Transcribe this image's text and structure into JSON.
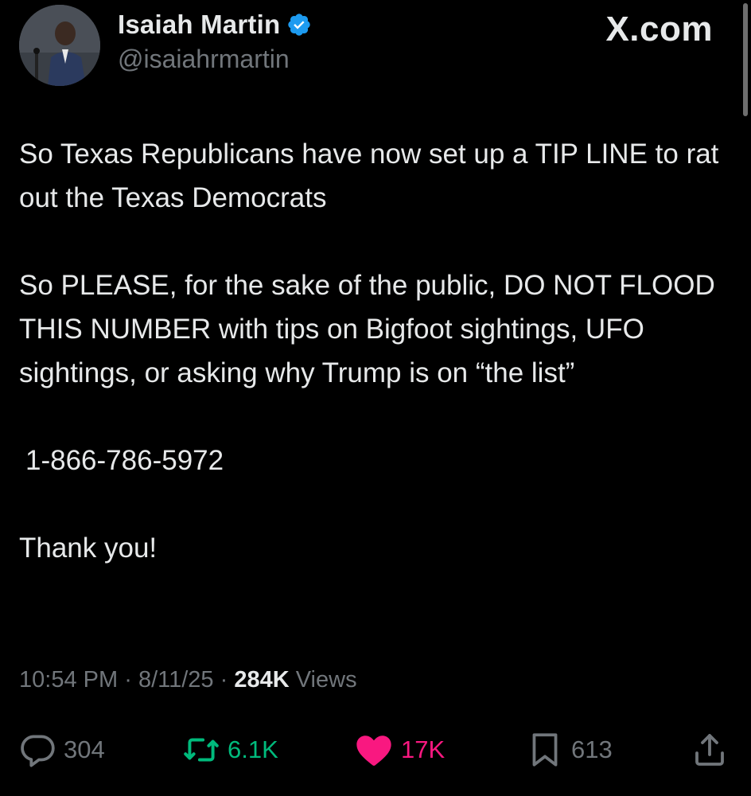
{
  "author": {
    "display_name": "Isaiah Martin",
    "handle": "@isaiahrmartin",
    "verified": true,
    "verified_color": "#1d9bf0"
  },
  "brand": {
    "label": "X.com"
  },
  "tweet": {
    "paragraphs": [
      "So Texas Republicans have now set up a TIP LINE to rat out the Texas Democrats",
      "So PLEASE, for the sake of the public, DO NOT FLOOD THIS NUMBER with tips on Bigfoot sightings, UFO sightings, or asking why Trump is on “the list”",
      "1-866-786-5972",
      "Thank you!"
    ]
  },
  "meta": {
    "time": "10:54 PM",
    "separator": "·",
    "date": "8/11/25",
    "views_count": "284K",
    "views_label": "Views"
  },
  "actions": {
    "replies": {
      "count": "304",
      "icon": "reply-icon",
      "color": "#71767b"
    },
    "reposts": {
      "count": "6.1K",
      "icon": "repost-icon",
      "color": "#00ba7c"
    },
    "likes": {
      "count": "17K",
      "icon": "heart-icon",
      "color": "#f91880"
    },
    "bookmarks": {
      "count": "613",
      "icon": "bookmark-icon",
      "color": "#71767b"
    },
    "share": {
      "icon": "share-icon",
      "color": "#71767b"
    }
  }
}
